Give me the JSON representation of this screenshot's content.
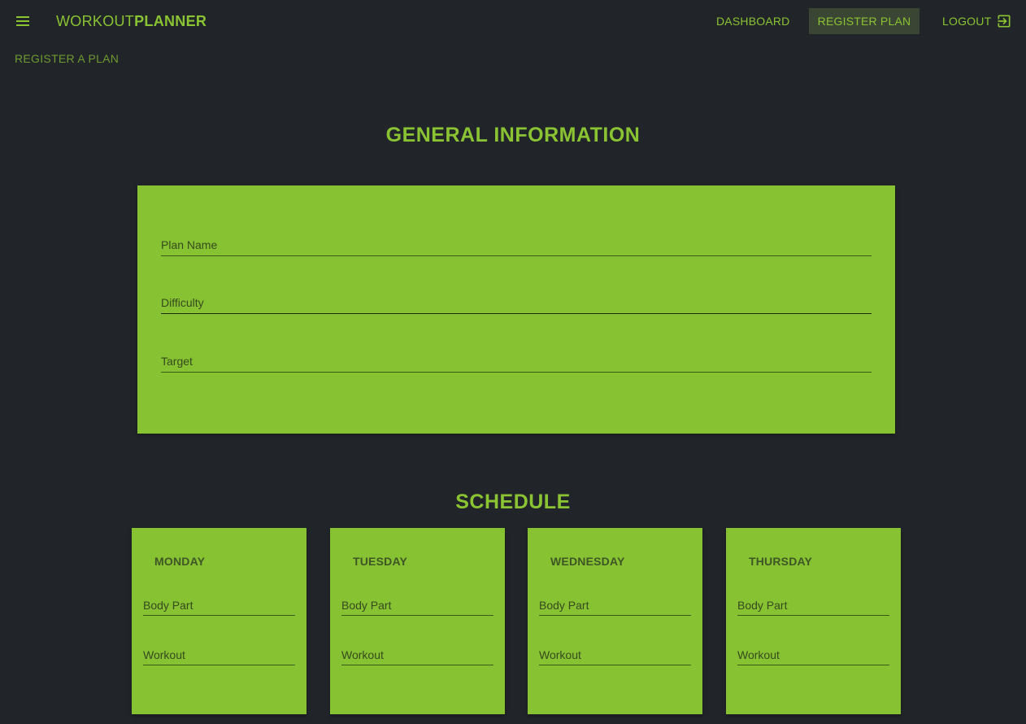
{
  "header": {
    "brand_light": "WORKOUT",
    "brand_bold": "PLANNER",
    "nav": {
      "dashboard": "DASHBOARD",
      "register_plan": "REGISTER PLAN",
      "logout": "LOGOUT"
    },
    "active_nav": "register_plan"
  },
  "breadcrumb": "REGISTER A PLAN",
  "general": {
    "title": "GENERAL INFORMATION",
    "fields": {
      "plan_name": {
        "label": "Plan Name",
        "value": ""
      },
      "difficulty": {
        "label": "Difficulty",
        "value": ""
      },
      "target": {
        "label": "Target",
        "value": ""
      }
    }
  },
  "schedule": {
    "title": "SCHEDULE",
    "days": [
      {
        "name": "MONDAY",
        "body_part_label": "Body Part",
        "workout_label": "Workout"
      },
      {
        "name": "TUESDAY",
        "body_part_label": "Body Part",
        "workout_label": "Workout"
      },
      {
        "name": "WEDNESDAY",
        "body_part_label": "Body Part",
        "workout_label": "Workout"
      },
      {
        "name": "THURSDAY",
        "body_part_label": "Body Part",
        "workout_label": "Workout"
      }
    ]
  },
  "colors": {
    "background": "#212529",
    "accent": "#86c232",
    "nav_active_bg": "#3b4534"
  },
  "icons": {
    "menu": "menu-icon",
    "logout": "logout-icon"
  }
}
